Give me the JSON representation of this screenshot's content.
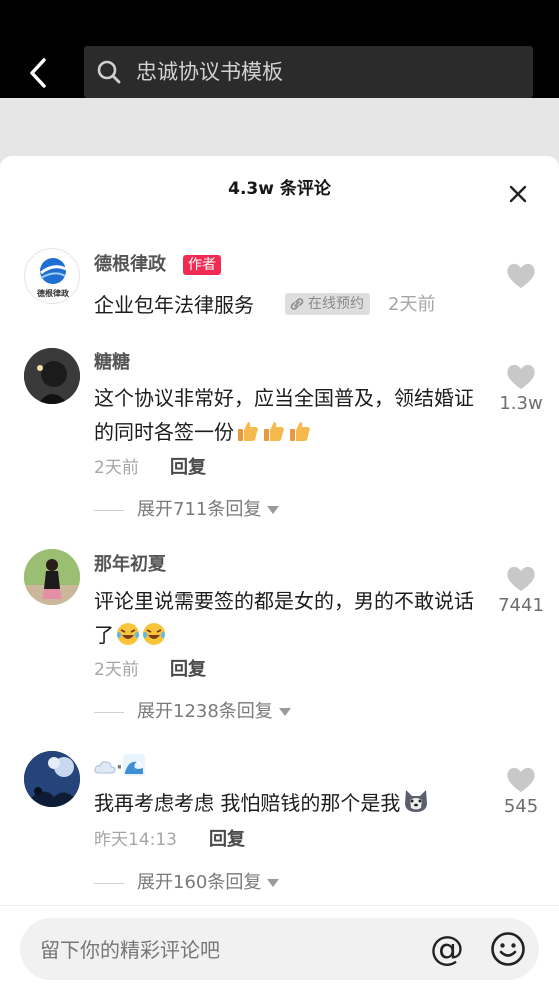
{
  "search": {
    "query": "忠诚协议书模板"
  },
  "sheet": {
    "title": "4.3w 条评论"
  },
  "comments": [
    {
      "username": "德根律政",
      "badge": "作者",
      "avatar_caption": "德根律政",
      "text": "企业包年法律服务",
      "tag": "在线预约",
      "time": "2天前"
    },
    {
      "username": "糖糖",
      "text": "这个协议非常好，应当全国普及，领结婚证的同时各签一份",
      "emojis": [
        "thumbs-up-icon",
        "thumbs-up-icon",
        "thumbs-up-icon"
      ],
      "time": "2天前",
      "reply_label": "回复",
      "likes": "1.3w",
      "expand": "展开711条回复"
    },
    {
      "username": "那年初夏",
      "text": "评论里说需要签的都是女的，男的不敢说话了",
      "emojis": [
        "laugh-cry-icon",
        "laugh-cry-icon"
      ],
      "time": "2天前",
      "reply_label": "回复",
      "likes": "7441",
      "expand": "展开1238条回复"
    },
    {
      "username_icons": [
        "cloud-icon",
        "wave-icon"
      ],
      "username_sep": "·",
      "text": "我再考虑考虑 我怕赔钱的那个是我",
      "emojis": [
        "husky-icon"
      ],
      "time": "昨天14:13",
      "reply_label": "回复",
      "likes": "545",
      "expand": "展开160条回复"
    }
  ],
  "input": {
    "placeholder": "留下你的精彩评论吧",
    "at_symbol": "@"
  },
  "colors": {
    "accent_badge": "#f02c52",
    "topbar": "#000000",
    "like_icon": "#c8c8c8"
  }
}
